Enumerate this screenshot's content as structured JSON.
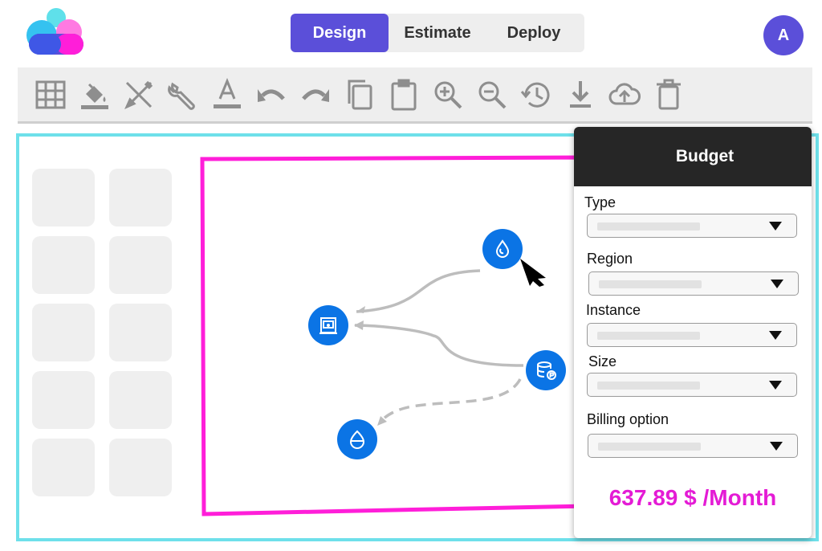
{
  "nav": {
    "tabs": [
      {
        "label": "Design",
        "active": true
      },
      {
        "label": "Estimate"
      },
      {
        "label": "Deploy"
      }
    ]
  },
  "user": {
    "avatar_initial": "A"
  },
  "toolbar": {
    "tools": [
      "grid-icon",
      "fill-icon",
      "tools-crossed-icon",
      "wrench-icon",
      "text-format-icon",
      "undo-icon",
      "redo-icon",
      "copy-icon",
      "clipboard-icon",
      "zoom-in-icon",
      "zoom-out-icon",
      "history-icon",
      "download-icon",
      "cloud-upload-icon",
      "trash-icon"
    ]
  },
  "panel": {
    "title": "Budget",
    "fields": [
      {
        "label": "Type"
      },
      {
        "label": "Region"
      },
      {
        "label": "Instance"
      },
      {
        "label": "Size"
      },
      {
        "label": "Billing option"
      }
    ],
    "price": "637.89 $ /Month"
  },
  "diagram": {
    "nodes": [
      "droplet-icon",
      "storage-icon",
      "database-icon",
      "bucket-icon"
    ]
  },
  "colors": {
    "accent": "#5b4fd9",
    "node": "#0b74e5",
    "group_border": "#ff1ed9",
    "canvas_border": "#6ee0ea",
    "price": "#e41bd5"
  }
}
